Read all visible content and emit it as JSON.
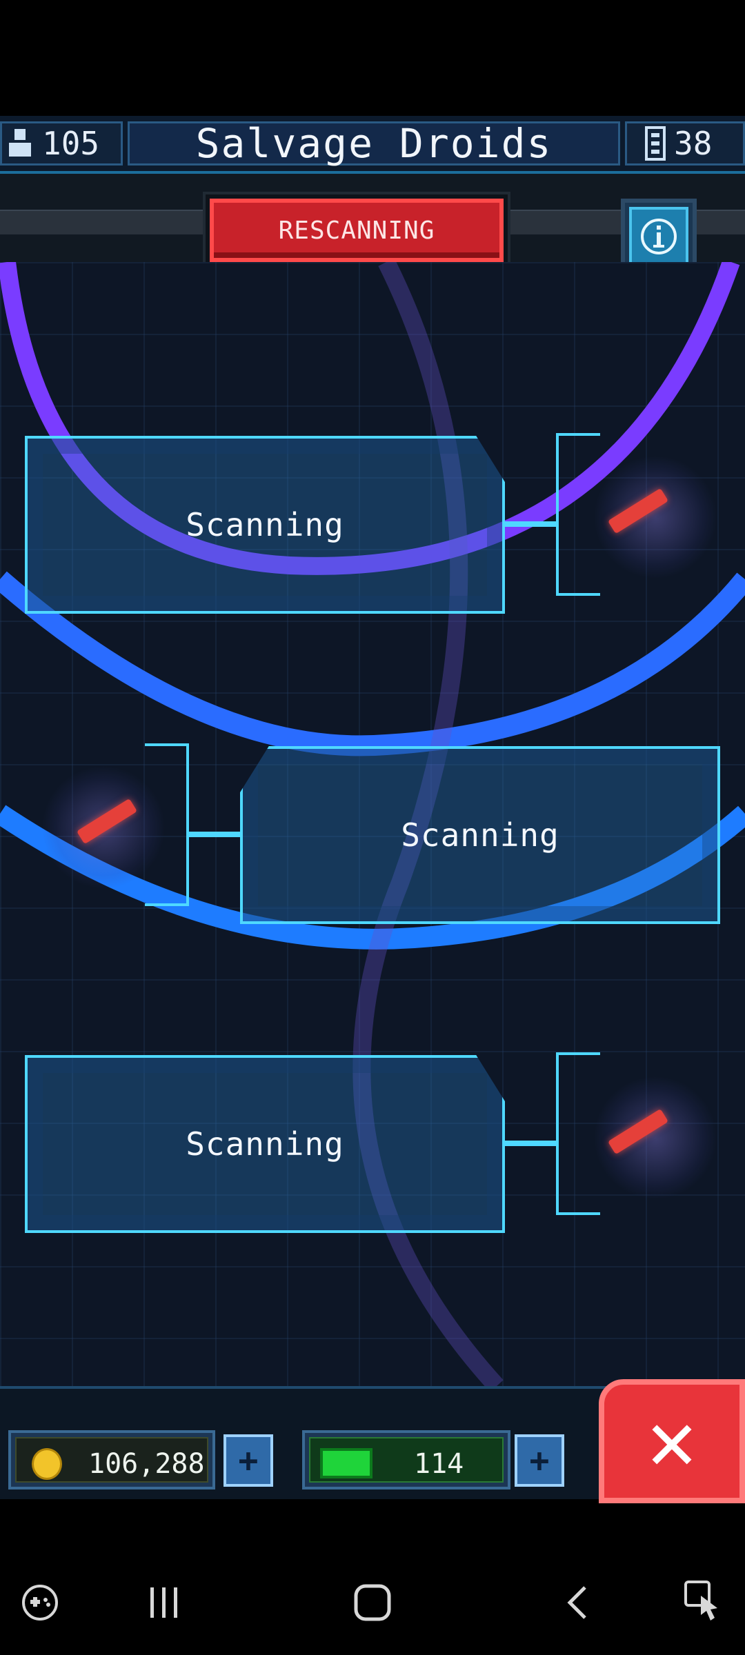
{
  "header": {
    "population": "105",
    "title": "Salvage Droids",
    "floors": "38"
  },
  "actions": {
    "rescan_label": "RESCANNING",
    "info_icon": "info-icon"
  },
  "slots": [
    {
      "label": "Scanning"
    },
    {
      "label": "Scanning"
    },
    {
      "label": "Scanning"
    }
  ],
  "resources": {
    "coins": "106,288",
    "coin_icon": "coin-icon",
    "gems": "114",
    "gem_icon": "bux-icon",
    "plus_label": "+"
  },
  "close": {
    "icon": "close-icon",
    "label": "✕"
  },
  "colors": {
    "panel_border": "#4fd8ff",
    "rescan_red": "#c8222a",
    "close_red": "#e8343a",
    "gem_green": "#1fd43a",
    "coin_gold": "#f2c42a"
  },
  "navbar": {
    "icons": [
      "game-launcher-icon",
      "recents-icon",
      "home-icon",
      "back-icon",
      "screenshot-assist-icon"
    ]
  }
}
